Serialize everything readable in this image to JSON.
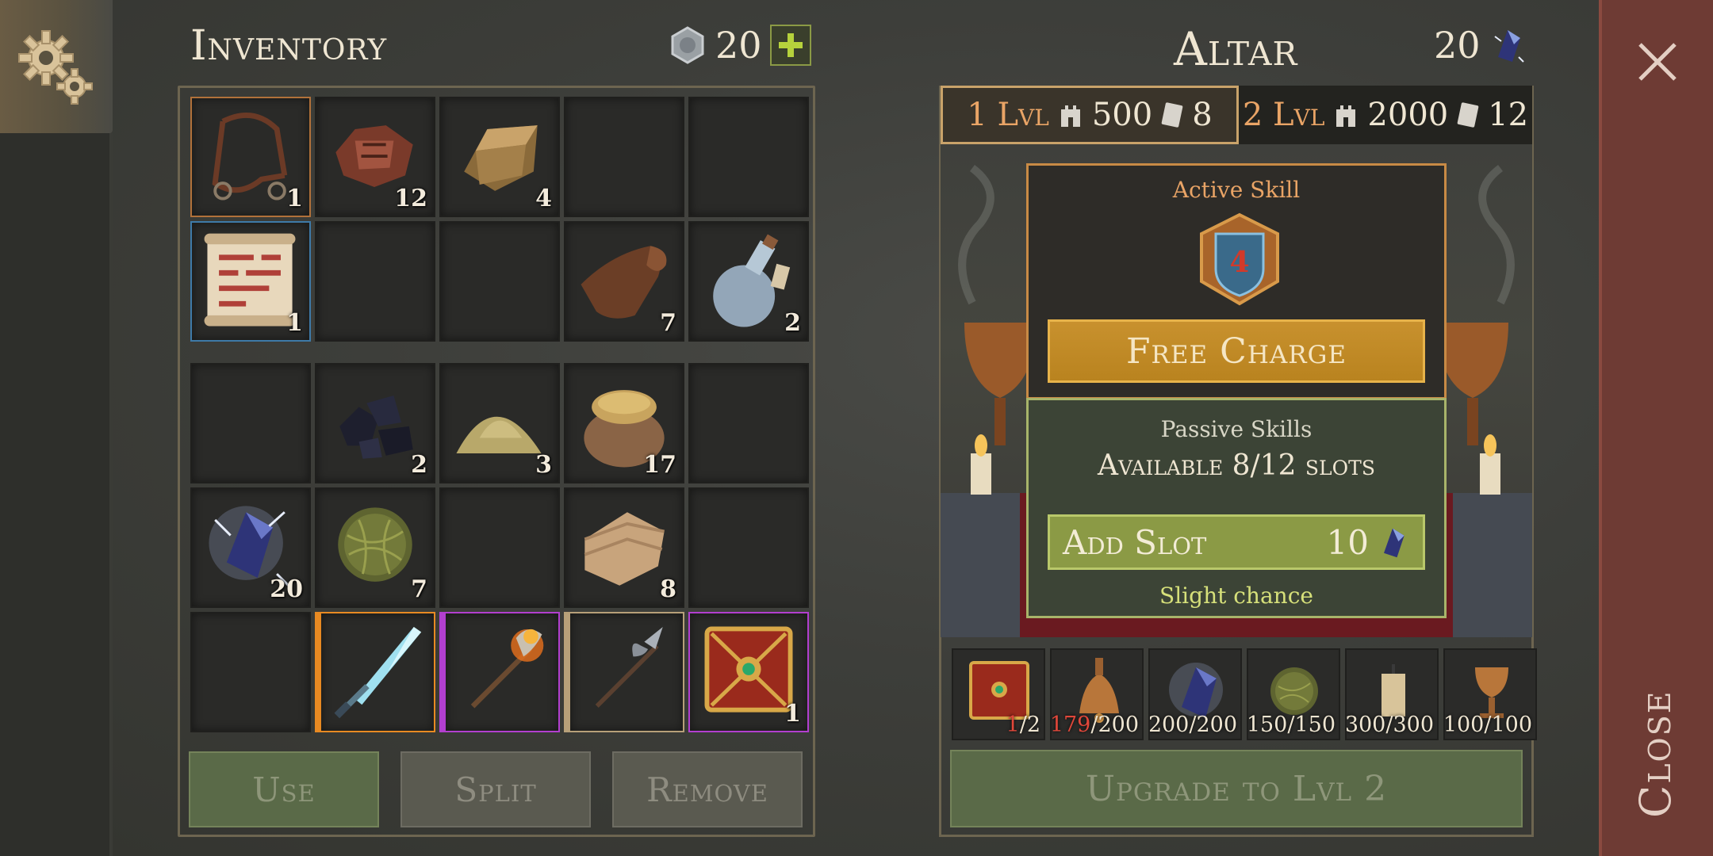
{
  "inventory": {
    "title": "Inventory",
    "currency_amount": "20",
    "grid_top": [
      {
        "icon": "bridle-icon",
        "qty": "1",
        "state": "selected"
      },
      {
        "icon": "scrap-leather-icon",
        "qty": "12"
      },
      {
        "icon": "gold-ingot-icon",
        "qty": "4"
      },
      {
        "icon": "",
        "qty": ""
      },
      {
        "icon": "",
        "qty": ""
      },
      {
        "icon": "scroll-icon",
        "qty": "1",
        "state": "highlight"
      },
      {
        "icon": "",
        "qty": ""
      },
      {
        "icon": "",
        "qty": ""
      },
      {
        "icon": "leather-roll-icon",
        "qty": "7"
      },
      {
        "icon": "potion-flask-icon",
        "qty": "2"
      }
    ],
    "grid_bottom": [
      {
        "icon": "",
        "qty": ""
      },
      {
        "icon": "coal-icon",
        "qty": "2"
      },
      {
        "icon": "sand-pile-icon",
        "qty": "3"
      },
      {
        "icon": "grain-sack-icon",
        "qty": "17"
      },
      {
        "icon": "",
        "qty": ""
      },
      {
        "icon": "crystal-icon",
        "qty": "20"
      },
      {
        "icon": "straw-bundle-icon",
        "qty": "7"
      },
      {
        "icon": "",
        "qty": ""
      },
      {
        "icon": "cloth-bolt-icon",
        "qty": "8"
      },
      {
        "icon": "",
        "qty": ""
      },
      {
        "icon": "",
        "qty": ""
      },
      {
        "icon": "ice-sword-icon",
        "qty": "",
        "rarity": "orange"
      },
      {
        "icon": "fire-axe-icon",
        "qty": "",
        "rarity": "purple"
      },
      {
        "icon": "halberd-icon",
        "qty": "",
        "rarity": "tan"
      },
      {
        "icon": "spell-book-icon",
        "qty": "1",
        "rarity": "purple-frame"
      }
    ],
    "buttons": {
      "use": "Use",
      "split": "Split",
      "remove": "Remove"
    }
  },
  "altar": {
    "title": "Altar",
    "crystal_amount": "20",
    "levels": [
      {
        "lvl": "1 Lvl",
        "gold": "500",
        "books": "8",
        "active": true
      },
      {
        "lvl": "2 Lvl",
        "gold": "2000",
        "books": "12",
        "active": false
      }
    ],
    "active_skill": {
      "label": "Active Skill",
      "level": "4",
      "button": "Free Charge"
    },
    "passive": {
      "label": "Passive Skills",
      "available": "Available 8/12 slots",
      "add_slot": "Add Slot",
      "add_slot_cost": "10",
      "chance": "Slight chance"
    },
    "requirements": [
      {
        "icon": "spell-book-icon",
        "have": "1",
        "need": "/2",
        "short": true
      },
      {
        "icon": "bell-icon",
        "have": "179",
        "need": "/200",
        "short": true
      },
      {
        "icon": "crystal-icon",
        "have": "200",
        "need": "/200",
        "short": false
      },
      {
        "icon": "straw-bundle-icon",
        "have": "150",
        "need": "/150",
        "short": false
      },
      {
        "icon": "candle-icon",
        "have": "300",
        "need": "/300",
        "short": false
      },
      {
        "icon": "chalice-icon",
        "have": "100",
        "need": "/100",
        "short": false
      }
    ],
    "upgrade": "Upgrade to Lvl 2"
  },
  "close_label": "Close",
  "colors": {
    "accent_orange": "#e9a466",
    "active_border": "#c88a45",
    "passive_border": "#a8b46a",
    "close_bg": "#6e3b34"
  }
}
